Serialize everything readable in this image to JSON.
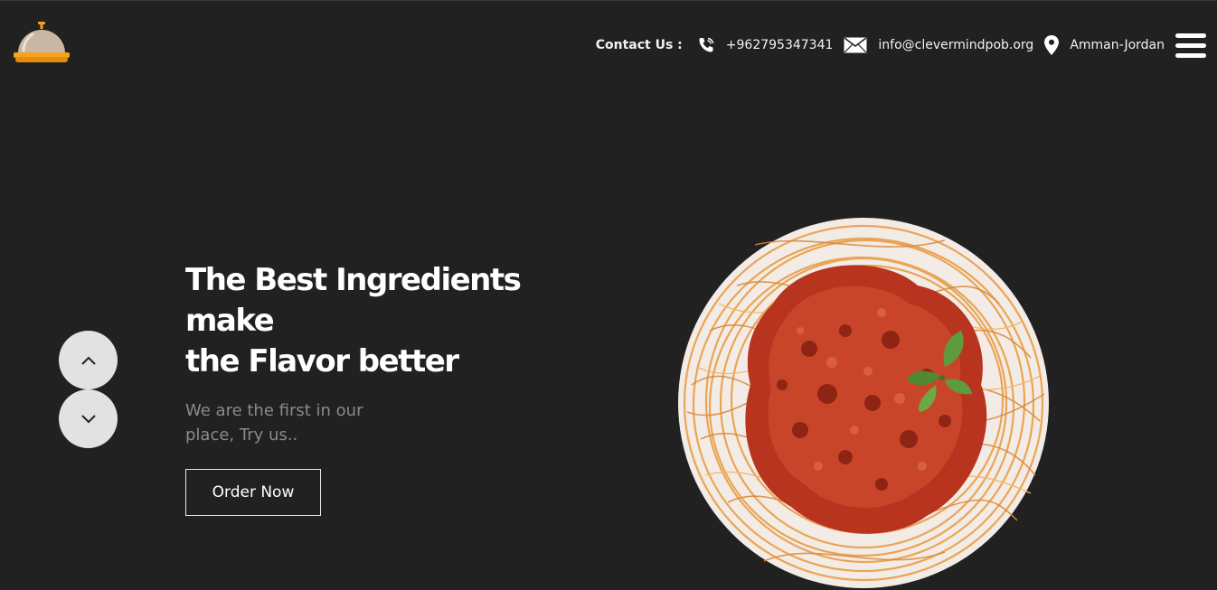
{
  "brand": {
    "logo_icon": "cloche-icon"
  },
  "header": {
    "contact_label": "Contact Us :",
    "phone": "+962795347341",
    "email": "info@clevermindpob.org",
    "location": "Amman-Jordan",
    "icons": {
      "phone": "phone-icon",
      "email": "envelope-icon",
      "location": "map-pin-icon",
      "menu": "hamburger-menu-icon"
    }
  },
  "hero": {
    "title_line1": "The Best Ingredients",
    "title_line2": "make",
    "title_line3": "the Flavor better",
    "subtitle": "We are the first in our place, Try us..",
    "cta_label": "Order Now"
  },
  "slider": {
    "up_icon": "chevron-up-icon",
    "down_icon": "chevron-down-icon"
  },
  "colors": {
    "background": "#212121",
    "accent": "#f7a21b",
    "text": "#ffffff",
    "muted": "#8a8a8a"
  }
}
